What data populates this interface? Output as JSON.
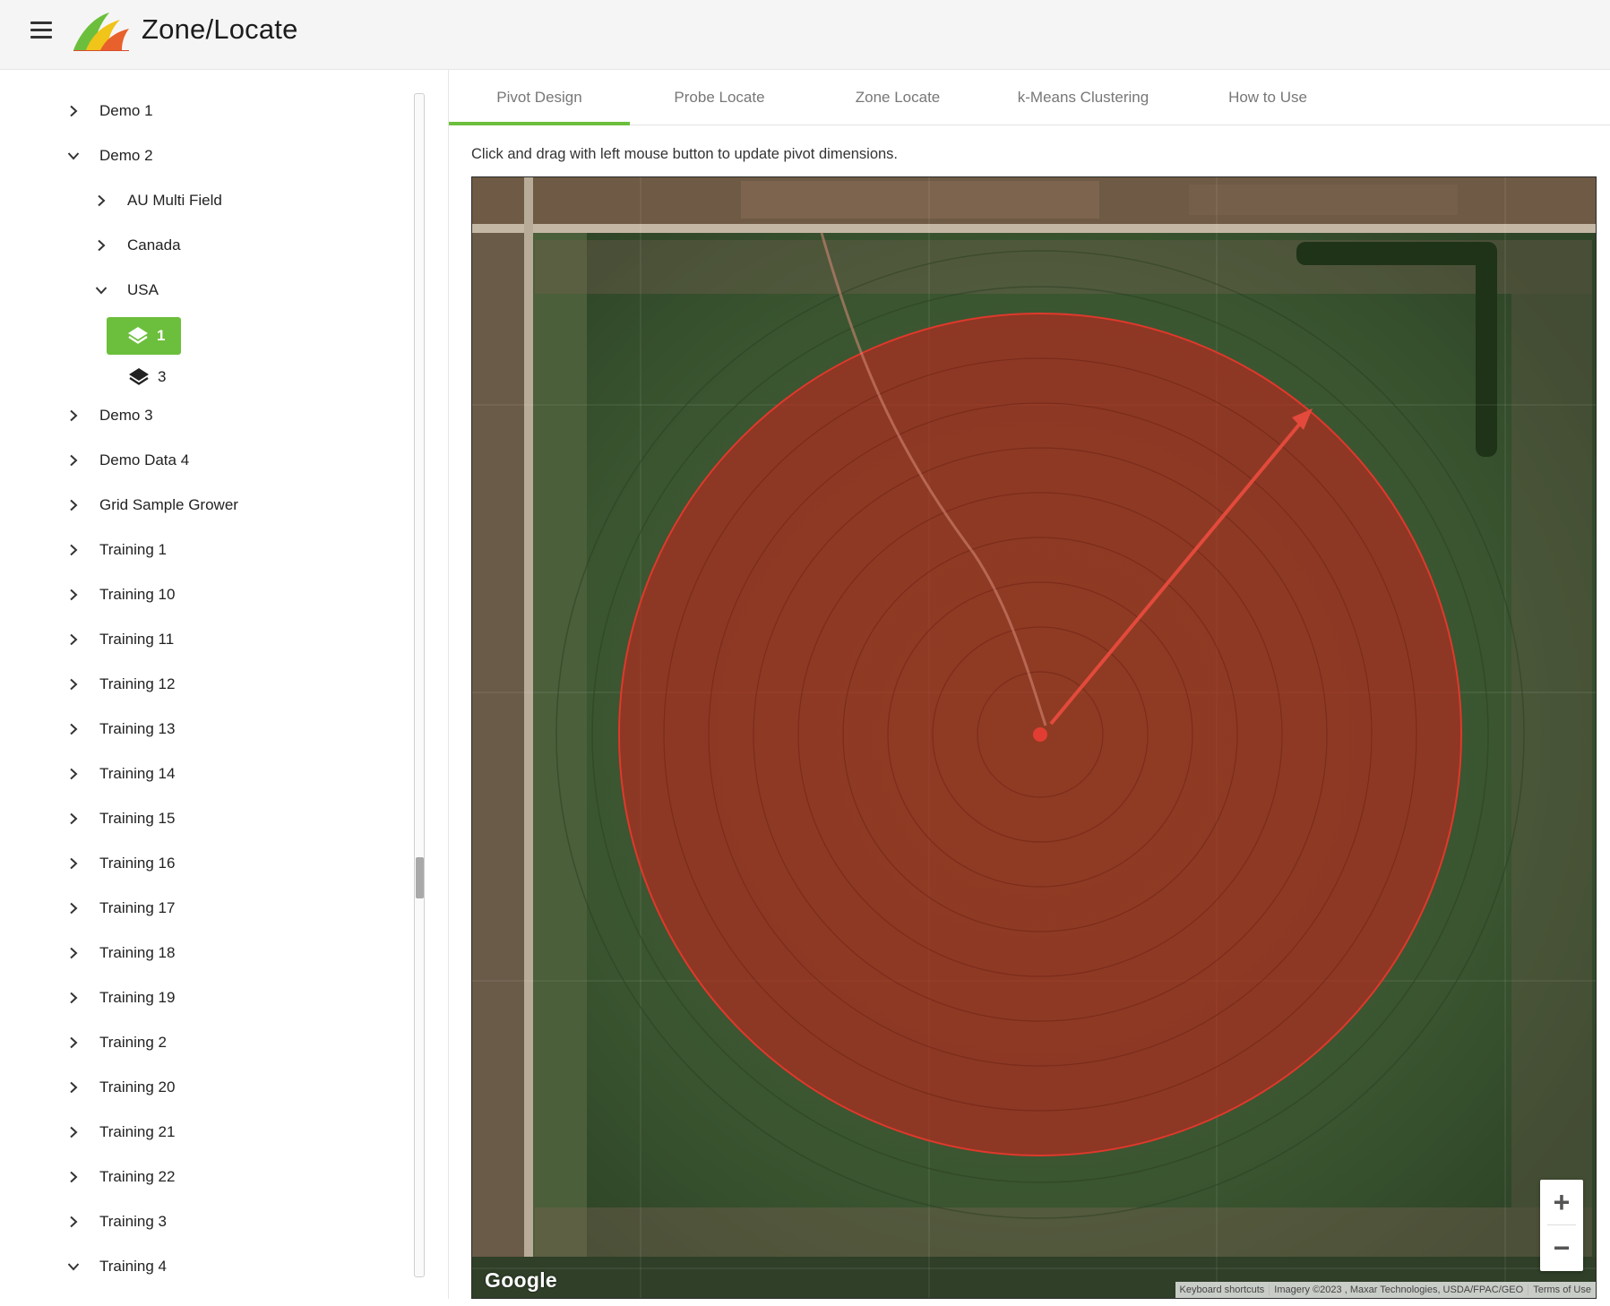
{
  "header": {
    "title": "Zone/Locate"
  },
  "tree": {
    "items": [
      {
        "label": "Demo 1",
        "expanded": false,
        "level": 0
      },
      {
        "label": "Demo 2",
        "expanded": true,
        "level": 0
      },
      {
        "label": "AU Multi Field",
        "expanded": false,
        "level": 1
      },
      {
        "label": "Canada",
        "expanded": false,
        "level": 1
      },
      {
        "label": "USA",
        "expanded": true,
        "level": 1
      },
      {
        "label": "Demo 3",
        "expanded": false,
        "level": 0
      },
      {
        "label": "Demo Data 4",
        "expanded": false,
        "level": 0
      },
      {
        "label": "Grid Sample Grower",
        "expanded": false,
        "level": 0
      },
      {
        "label": "Training 1",
        "expanded": false,
        "level": 0
      },
      {
        "label": "Training 10",
        "expanded": false,
        "level": 0
      },
      {
        "label": "Training 11",
        "expanded": false,
        "level": 0
      },
      {
        "label": "Training 12",
        "expanded": false,
        "level": 0
      },
      {
        "label": "Training 13",
        "expanded": false,
        "level": 0
      },
      {
        "label": "Training 14",
        "expanded": false,
        "level": 0
      },
      {
        "label": "Training 15",
        "expanded": false,
        "level": 0
      },
      {
        "label": "Training 16",
        "expanded": false,
        "level": 0
      },
      {
        "label": "Training 17",
        "expanded": false,
        "level": 0
      },
      {
        "label": "Training 18",
        "expanded": false,
        "level": 0
      },
      {
        "label": "Training 19",
        "expanded": false,
        "level": 0
      },
      {
        "label": "Training 2",
        "expanded": false,
        "level": 0
      },
      {
        "label": "Training 20",
        "expanded": false,
        "level": 0
      },
      {
        "label": "Training 21",
        "expanded": false,
        "level": 0
      },
      {
        "label": "Training 22",
        "expanded": false,
        "level": 0
      },
      {
        "label": "Training 3",
        "expanded": false,
        "level": 0
      },
      {
        "label": "Training 4",
        "expanded": true,
        "level": 0
      }
    ],
    "leaves": [
      {
        "label": "1",
        "selected": true
      },
      {
        "label": "3",
        "selected": false
      }
    ]
  },
  "tabs": [
    {
      "label": "Pivot Design",
      "active": true
    },
    {
      "label": "Probe Locate",
      "active": false
    },
    {
      "label": "Zone Locate",
      "active": false
    },
    {
      "label": "k-Means Clustering",
      "active": false
    },
    {
      "label": "How to Use",
      "active": false
    }
  ],
  "instruction": "Click and drag with left mouse button to update pivot dimensions.",
  "map": {
    "zoom_in_label": "+",
    "zoom_out_label": "−",
    "google_label": "Google",
    "attribution": {
      "keyboard": "Keyboard shortcuts",
      "imagery": "Imagery ©2023 , Maxar Technologies, USDA/FPAC/GEO",
      "terms": "Terms of Use"
    }
  },
  "colors": {
    "accent": "#6cbf3c",
    "pivot_fill": "#c0251d",
    "pivot_stroke": "#e0382c"
  }
}
